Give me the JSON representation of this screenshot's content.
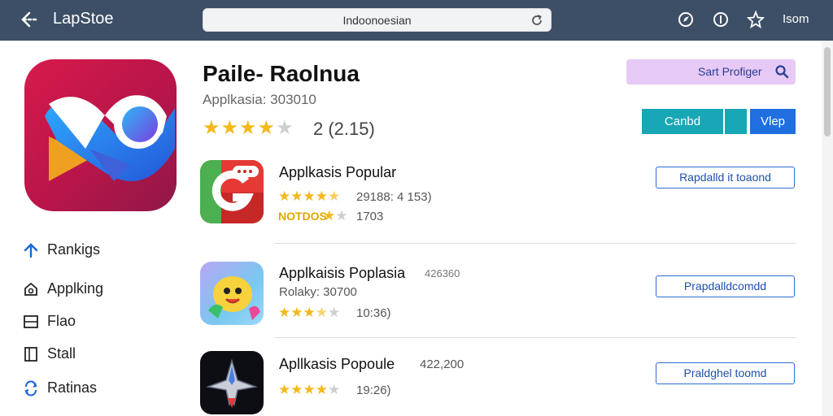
{
  "topbar": {
    "app_name": "LapStoe",
    "url_text": "Indoonoesian",
    "right_text": "Isom"
  },
  "hero": {
    "title": "Paile- Raolnua",
    "subtitle": "Applkasia: 303010",
    "rating_text": "2 (2.15)",
    "stars_filled": 4,
    "stars_total": 5
  },
  "actions": {
    "search_label": "Sart Profiger",
    "cand_label": "Canbd",
    "view_label": "Vlep"
  },
  "sidebar": {
    "items": [
      {
        "label": "Rankigs",
        "icon": "arrow-up-icon"
      },
      {
        "label": "Applking",
        "icon": "home-icon"
      },
      {
        "label": "Flao",
        "icon": "box-icon"
      },
      {
        "label": "Stall",
        "icon": "book-icon"
      },
      {
        "label": "Ratinas",
        "icon": "refresh-icon"
      }
    ]
  },
  "rows": [
    {
      "title": "Applkasis Popular",
      "meta": "29188: 4 153)",
      "badge": "NOTDOS",
      "meta2": "1703",
      "rating": 4.5,
      "button": "Rapdalld it toaond"
    },
    {
      "title": "Applkaisis Poplasia",
      "side_meta": "426360",
      "meta": "Rolaky: 30700",
      "meta2": "10:36)",
      "rating": 3.5,
      "button": "Prapdalldcomdd"
    },
    {
      "title": "Apllkasis Popoule",
      "side_meta": "422,200",
      "meta2": "19:26)",
      "rating": 4,
      "button": "Praldghel toomd"
    }
  ],
  "colors": {
    "topbar": "#3d4f66",
    "accent_blue": "#1f6fe0",
    "teal": "#18a7b5",
    "star": "#f3b81b",
    "search_bg": "#e6c9f5"
  }
}
